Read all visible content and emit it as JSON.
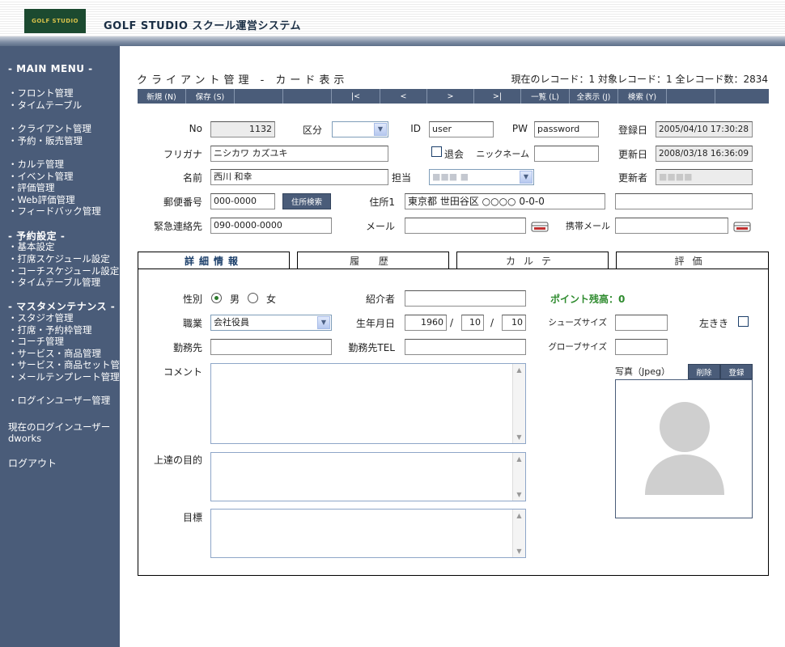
{
  "header": {
    "logo_text": "GOLF STUDIO",
    "app_title": "GOLF STUDIO スクール運営システム"
  },
  "sidebar": {
    "main_menu": "- MAIN MENU -",
    "group1": [
      "・フロント管理",
      "・タイムテーブル"
    ],
    "group2": [
      "・クライアント管理",
      "・予約・販売管理"
    ],
    "group3": [
      "・カルテ管理",
      "・イベント管理",
      "・評価管理",
      "・Web評価管理",
      "・フィードバック管理"
    ],
    "settings_title": "- 予約設定 -",
    "group4": [
      "・基本設定",
      "・打席スケジュール設定",
      "・コーチスケジュール設定",
      "・タイムテーブル管理"
    ],
    "master_title": "- マスタメンテナンス -",
    "group5": [
      "・スタジオ管理",
      "・打席・予約枠管理",
      "・コーチ管理",
      "・サービス・商品管理",
      "・サービス・商品セット管理",
      "・メールテンプレート管理"
    ],
    "login_user_mgmt": "・ログインユーザー管理",
    "current_user_label": "現在のログインユーザー",
    "current_user": "dworks",
    "logout": "ログアウト"
  },
  "page": {
    "title": "クライアント管理 - カード表示",
    "record_info": "現在のレコード：1 対象レコード：1 全レコード数：2834"
  },
  "toolbar": {
    "new": "新規 (N)",
    "save": "保存 (S)",
    "first": "|<",
    "prev": "<",
    "next": ">",
    "last": ">|",
    "list": "一覧 (L)",
    "show_all": "全表示 (J)",
    "search": "検索 (Y)"
  },
  "form": {
    "no_label": "No",
    "no_value": "1132",
    "kubun_label": "区分",
    "kubun_value": "",
    "id_label": "ID",
    "id_value": "user",
    "pw_label": "PW",
    "pw_value": "password",
    "regdate_label": "登録日",
    "regdate_value": "2005/04/10 17:30:28",
    "furigana_label": "フリガナ",
    "furigana_value": "ニシカワ カズユキ",
    "taikai_label": "退会",
    "nickname_label": "ニックネーム",
    "nickname_value": "",
    "update_label": "更新日",
    "update_value": "2008/03/18 16:36:09",
    "name_label": "名前",
    "name_value": "西川 和幸",
    "tanto_label": "担当",
    "tanto_value": "■■■ ■",
    "updater_label": "更新者",
    "updater_value": "■■■■",
    "zip_label": "郵便番号",
    "zip_value": "000-0000",
    "zip_search": "住所検索",
    "addr_label": "住所1",
    "addr_value": "東京都 世田谷区 ○○○○ 0-0-0",
    "addr2_value": "",
    "emergency_label": "緊急連絡先",
    "emergency_value": "090-0000-0000",
    "mail_label": "メール",
    "mail_value": "",
    "mobile_mail_label": "携帯メール",
    "mobile_mail_value": ""
  },
  "tabs": [
    "詳細情報",
    "履 歴",
    "カルテ",
    "評価"
  ],
  "detail": {
    "gender_label": "性別",
    "male": "男",
    "female": "女",
    "gender_selected": "男",
    "referrer_label": "紹介者",
    "referrer_value": "",
    "points": "ポイント残高：0",
    "job_label": "職業",
    "job_value": "会社役員",
    "birth_label": "生年月日",
    "birth_year": "1960",
    "birth_month": "10",
    "birth_day": "10",
    "sep": "/",
    "shoe_label": "シューズサイズ",
    "shoe_value": "",
    "lefty_label": "左きき",
    "work_label": "勤務先",
    "work_value": "",
    "work_tel_label": "勤務先TEL",
    "work_tel_value": "",
    "glove_label": "グローブサイズ",
    "glove_value": "",
    "comment_label": "コメント",
    "goal_label": "上達の目的",
    "target_label": "目標",
    "photo_label": "写真（Jpeg）",
    "photo_delete": "削除",
    "photo_register": "登録"
  },
  "colors": {
    "nav": "#4a5c79",
    "points_green": "#2e8b2e",
    "logo_bg": "#1c4a30"
  }
}
